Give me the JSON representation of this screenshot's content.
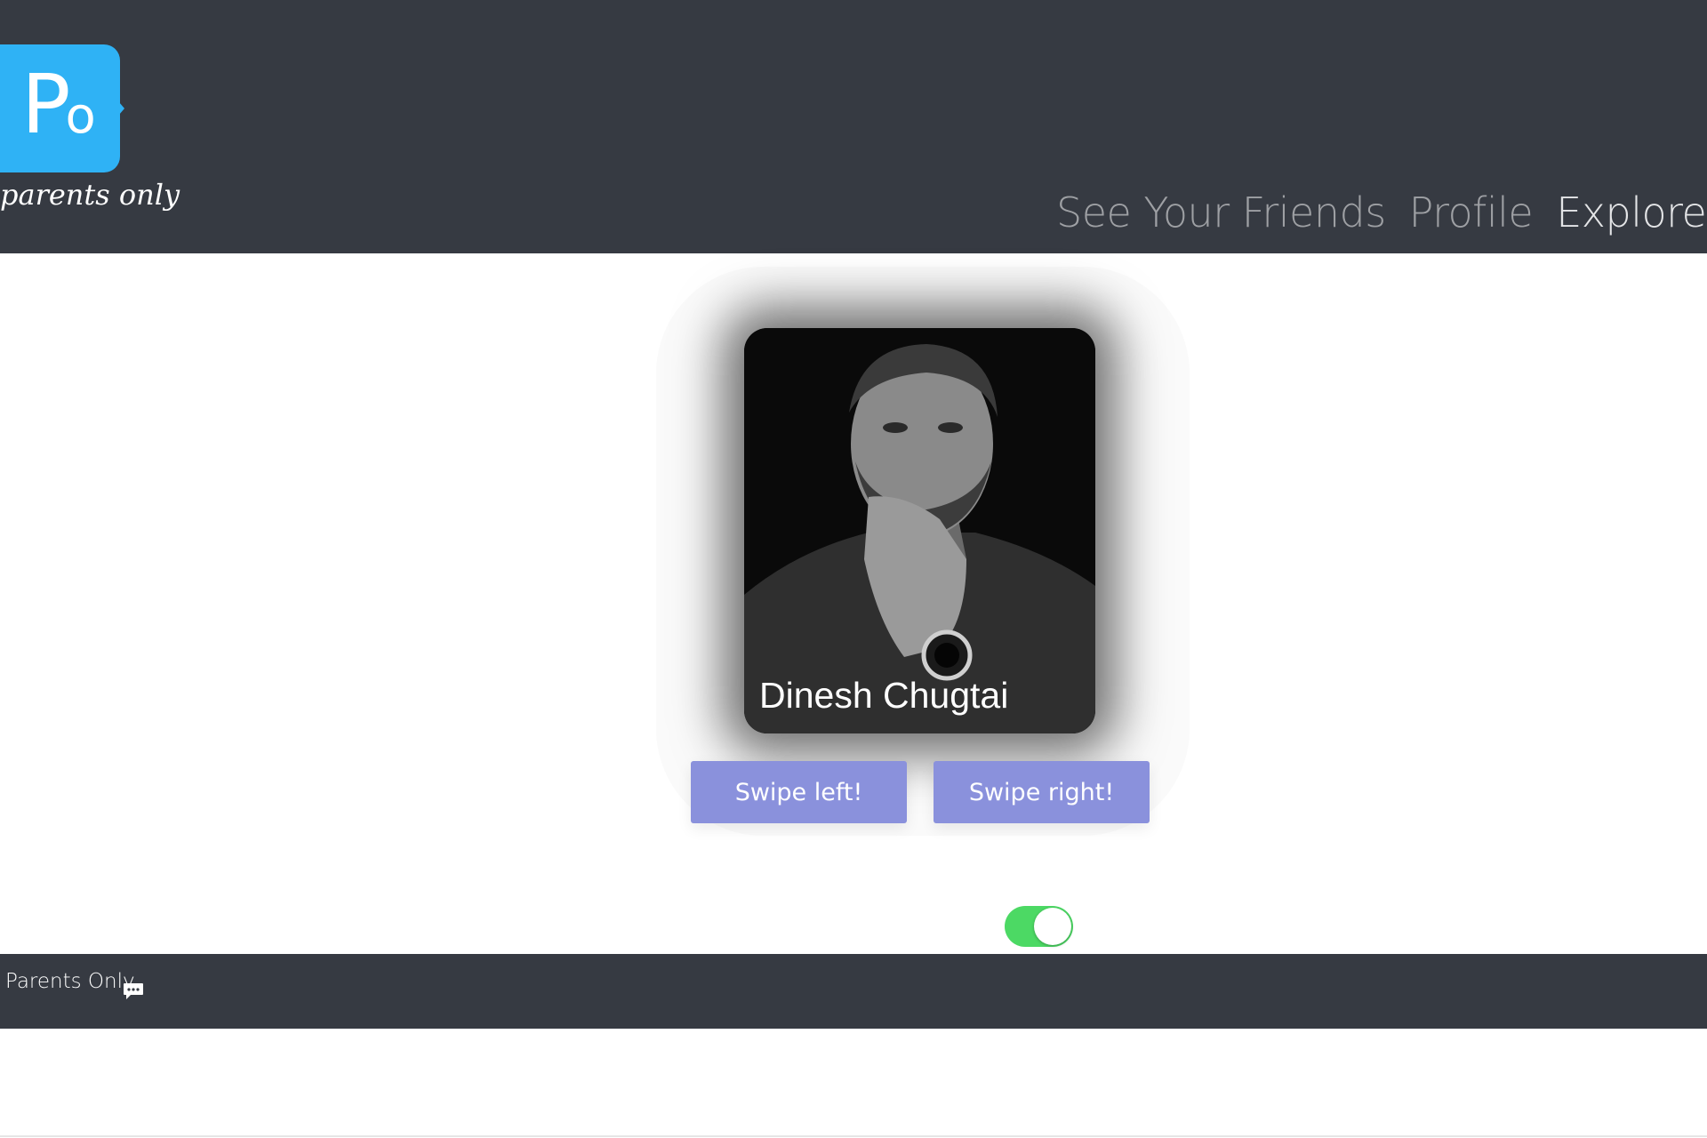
{
  "logo": {
    "mark_p": "P",
    "mark_o": "o",
    "tagline": "parents only"
  },
  "nav": {
    "items": [
      {
        "label": "See Your Friends",
        "active": false
      },
      {
        "label": "Profile",
        "active": false
      },
      {
        "label": "Explore Parents",
        "active": true
      }
    ]
  },
  "card": {
    "name": "Dinesh Chugtai"
  },
  "actions": {
    "swipe_left_label": "Swipe left!",
    "swipe_right_label": "Swipe right!"
  },
  "toggle": {
    "on": true,
    "color": "#4cd964"
  },
  "footer": {
    "text": "Parents Only",
    "icon": "chat-bubble-icon"
  },
  "colors": {
    "header_bg": "#363a42",
    "logo_blue": "#2fb2f5",
    "button_bg": "#8a91dc"
  }
}
